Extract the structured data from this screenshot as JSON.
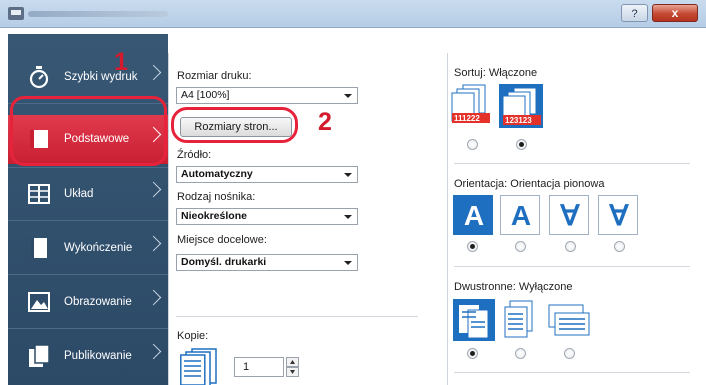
{
  "window": {
    "help_label": "?",
    "close_label": "x"
  },
  "sidebar": {
    "items": [
      {
        "label": "Szybki wydruk",
        "icon": "stopwatch-icon",
        "active": false
      },
      {
        "label": "Podstawowe",
        "icon": "basic-page-icon",
        "active": true
      },
      {
        "label": "Układ",
        "icon": "layout-grid-icon",
        "active": false
      },
      {
        "label": "Wykończenie",
        "icon": "finishing-icon",
        "active": false
      },
      {
        "label": "Obrazowanie",
        "icon": "image-icon",
        "active": false
      },
      {
        "label": "Publikowanie",
        "icon": "publishing-icon",
        "active": false
      }
    ]
  },
  "callouts": {
    "step1": "1",
    "step2": "2",
    "color": "#e6233a"
  },
  "basic": {
    "print_size_label": "Rozmiar druku:",
    "print_size_value": "A4 [100%]",
    "page_sizes_button": "Rozmiary stron...",
    "source_label": "Źródło:",
    "source_value": "Automatyczny",
    "media_type_label": "Rodzaj nośnika:",
    "media_type_value": "Nieokreślone",
    "destination_label": "Miejsce docelowe:",
    "destination_value": "Domyśl. drukarki",
    "copies_label": "Kopie:",
    "copies_value": "1"
  },
  "collate": {
    "label": "Sortuj:",
    "value": "Włączone",
    "off_sample": "111222",
    "on_sample": "123123",
    "selected": 1
  },
  "orientation": {
    "label": "Orientacja:",
    "value": "Orientacja pionowa",
    "glyphs": [
      "A",
      "A",
      "∀",
      "∀"
    ],
    "selected": 0
  },
  "duplex": {
    "label": "Dwustronne:",
    "value": "Wyłączone",
    "selected": 0
  },
  "colors": {
    "accent": "#1f6fc0",
    "sidebar": "#2f4f6d",
    "active": "#d42a3e"
  }
}
